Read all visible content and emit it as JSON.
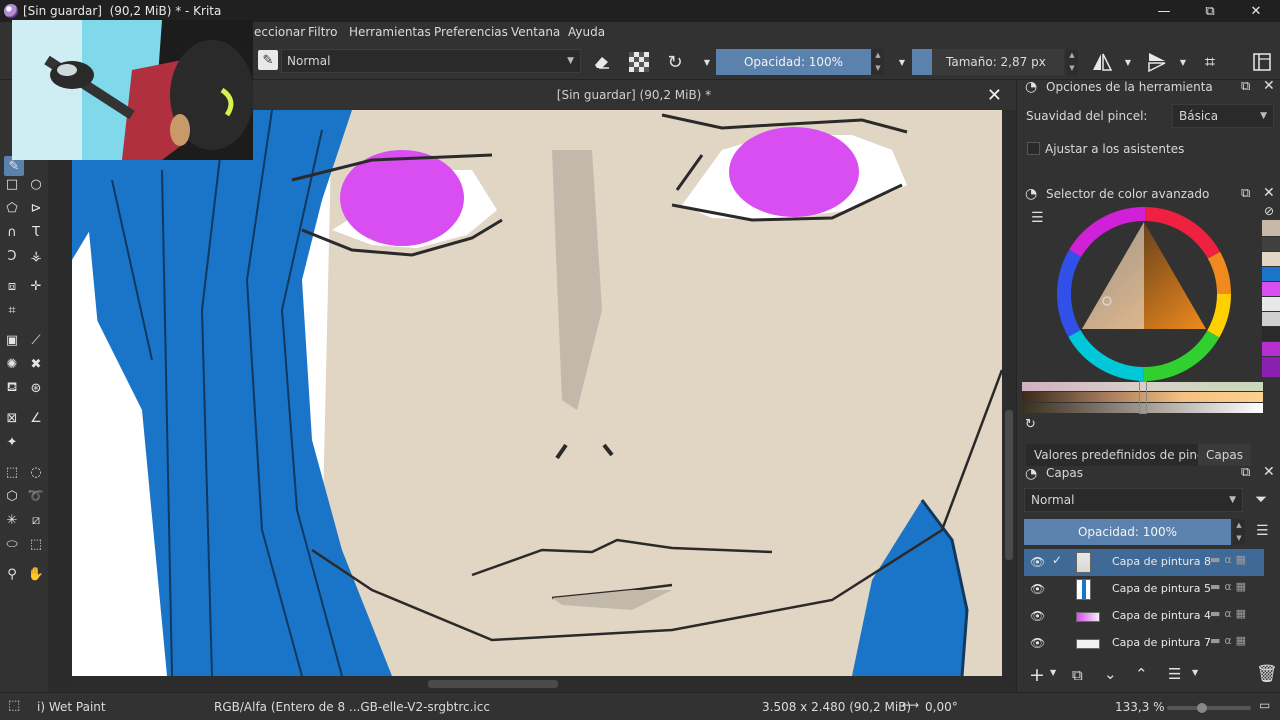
{
  "window": {
    "title": "[Sin guardar]  (90,2 MiB) * - Krita",
    "minimize_glyph": "—",
    "maximize_glyph": "⧉",
    "close_glyph": "✕"
  },
  "menu": {
    "items": [
      "eccionar",
      "Filtro",
      "Herramientas",
      "Preferencias",
      "Ventana",
      "Ayuda"
    ]
  },
  "toolbar": {
    "blend_mode": "Normal",
    "opacity": "Opacidad: 100%",
    "size": "Tamaño: 2,87 px"
  },
  "document": {
    "tab_title": "[Sin guardar]  (90,2 MiB) *",
    "close_glyph": "✕"
  },
  "tool_options": {
    "title": "Opciones de la herramienta",
    "smoothing_label": "Suavidad del pincel:",
    "smoothing_value": "Básica",
    "assistants_label": "Ajustar a los asistentes"
  },
  "color_selector": {
    "title": "Selector de color avanzado",
    "hue_color": "#f08a1e",
    "recent_colors": [
      "#c8b8a8",
      "#404040",
      "#e1d5c4",
      "#1a75c8",
      "#d94ef0",
      "#e8e8e8",
      "#cfcfcf",
      "#2a2a2a",
      "#b52fd0",
      "#8a1fb0"
    ]
  },
  "dock_tabs": {
    "brush_presets": "Valores predefinidos de pincel",
    "layers": "Capas"
  },
  "layers": {
    "title": "Capas",
    "blend_mode": "Normal",
    "opacity": "Opacidad:  100%",
    "items": [
      {
        "name": "Capa de pintura 8",
        "active": true,
        "visible": true
      },
      {
        "name": "Capa de pintura 5",
        "active": false,
        "visible": true
      },
      {
        "name": "Capa de pintura 4",
        "active": false,
        "visible": true
      },
      {
        "name": "Capa de pintura 7",
        "active": false,
        "visible": true
      }
    ]
  },
  "status": {
    "brush": "i) Wet Paint",
    "color_space": "RGB/Alfa (Entero de 8 ...GB-elle-V2-srgbtrc.icc",
    "dimensions": "3.508 x 2.480 (90,2 MiB)",
    "rotation": "0,00°",
    "zoom": "133,3 %"
  }
}
